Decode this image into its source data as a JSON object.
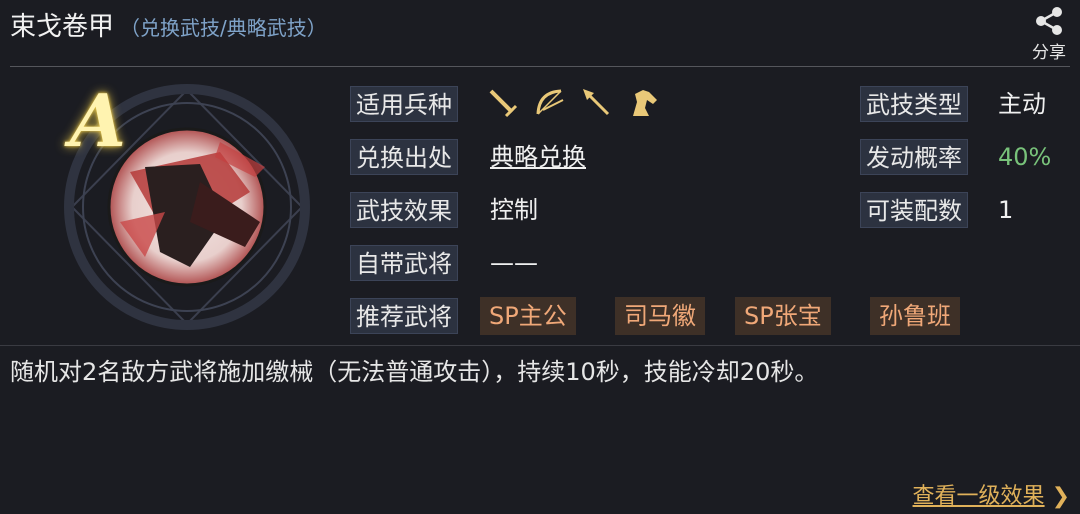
{
  "header": {
    "title": "束戈卷甲",
    "subtitle": "（兑换武技/典略武技）",
    "share_label": "分享"
  },
  "skill": {
    "grade": "A"
  },
  "info": {
    "troop_label": "适用兵种",
    "troop_icons": [
      "sword-icon",
      "bow-icon",
      "spear-icon",
      "horse-icon"
    ],
    "source_label": "兑换出处",
    "source_value": "典略兑换",
    "effect_label": "武技效果",
    "effect_value": "控制",
    "own_general_label": "自带武将",
    "own_general_value": "——",
    "recommend_label": "推荐武将",
    "recommend": [
      "SP主公",
      "司马徽",
      "SP张宝",
      "孙鲁班"
    ],
    "type_label": "武技类型",
    "type_value": "主动",
    "chance_label": "发动概率",
    "chance_value": "40%",
    "equip_label": "可装配数",
    "equip_value": "1"
  },
  "description": "随机对2名敌方武将施加缴械（无法普通攻击），持续10秒，技能冷却20秒。",
  "footer": {
    "more_label": "查看一级效果",
    "more_arrow": "❯"
  },
  "colors": {
    "background": "#1b1c22",
    "label_bg": "#2c3240",
    "tag_bg": "#3e3027",
    "tag_text": "#f0a878",
    "green": "#78c27a",
    "gold": "#e0b15a",
    "subtitle": "#7fa3c9"
  }
}
